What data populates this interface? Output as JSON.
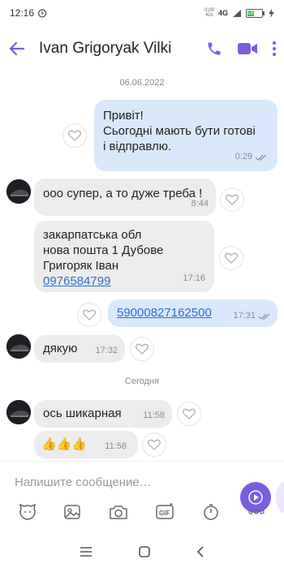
{
  "status_bar": {
    "time": "12:16",
    "speed_top": "0,00",
    "speed_bottom": "K/s",
    "network": "4G",
    "battery": "16"
  },
  "header": {
    "title": "Ivan Grigoryak Vilki"
  },
  "messages": {
    "date1": "06.06.2022",
    "m1": {
      "line1": "Привіт!",
      "line2": "Сьогодні мають бути готові",
      "line3": "і відправлю.",
      "time": "0:29"
    },
    "m2": {
      "text": "ооо супер, а то дуже треба !",
      "time": "8:44"
    },
    "m3": {
      "line1": "закарпатська обл",
      "line2": "нова пошта 1 Дубове",
      "line3": "Григоряк Іван",
      "phone": "0976584799",
      "time": "17:16"
    },
    "m4": {
      "text": "59000827162500",
      "time": "17:31"
    },
    "m5": {
      "text": "дякую",
      "time": "17:32"
    },
    "date2": "Сегодня",
    "m6": {
      "text": "ось шикарная",
      "time": "11:58"
    },
    "m7": {
      "text": "👍👍👍",
      "time": "11:58"
    }
  },
  "composer": {
    "placeholder": "Напишите сообщение…"
  },
  "colors": {
    "accent": "#7a5de0",
    "incoming_bubble": "#ececec",
    "outgoing_bubble": "#d9e8fb",
    "link": "#2d6fc7"
  }
}
